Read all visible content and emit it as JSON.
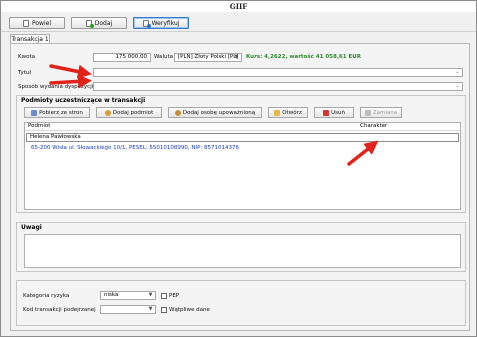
{
  "window": {
    "title": "GIIF"
  },
  "toolbar": {
    "buttons": [
      {
        "label": "Powiel",
        "icon": "copy-page-icon"
      },
      {
        "label": "Dodaj",
        "icon": "add-page-icon"
      },
      {
        "label": "Weryfikuj",
        "icon": "verify-icon"
      }
    ]
  },
  "tabs": [
    {
      "label": "Transakcja 1"
    }
  ],
  "form": {
    "kwota_label": "Kwota",
    "kwota_value": "175 000,00",
    "waluta_label": "Waluta",
    "waluta_value": "[PLN] Złoty Polski [PL]",
    "kurs_text": "Kurs: 4,2622, wartość 41 058,61 EUR",
    "tytul_label": "Tytuł",
    "tytul_value": "",
    "sposob_label": "Sposób wydania dyspozycji",
    "sposob_value": ""
  },
  "participants": {
    "title": "Podmioty uczestniczące w transakcji",
    "buttons": [
      {
        "label": "Pobierz ze stron",
        "enabled": true
      },
      {
        "label": "Dodaj podmiot",
        "enabled": true
      },
      {
        "label": "Dodaj osobę upoważnioną",
        "enabled": true
      },
      {
        "label": "Otwórz",
        "enabled": true
      },
      {
        "label": "Usuń",
        "enabled": true
      },
      {
        "label": "Zamiana",
        "enabled": false
      }
    ],
    "columns": [
      "Podmiot",
      "Charakter"
    ],
    "rows": [
      {
        "name": "Helena Pawłowska",
        "charakter": "",
        "details": "65-200 Wisła ul. Słowackiego 10/1, PESEL: 55010108990, NIP: 8571014376"
      }
    ]
  },
  "uwagi": {
    "label": "Uwagi",
    "value": ""
  },
  "bottom": {
    "kategoria_label": "Kategoria ryzyka",
    "kategoria_value": "niska",
    "pep_label": "PEP",
    "kod_label": "Kod transakcji podejrzanej",
    "kod_value": "",
    "watpliwe_label": "Wątpliwe dane"
  },
  "colors": {
    "annotation_arrow": "#e0241b",
    "kurs_text": "#2f8a2f",
    "details_text": "#1b3fc4"
  }
}
